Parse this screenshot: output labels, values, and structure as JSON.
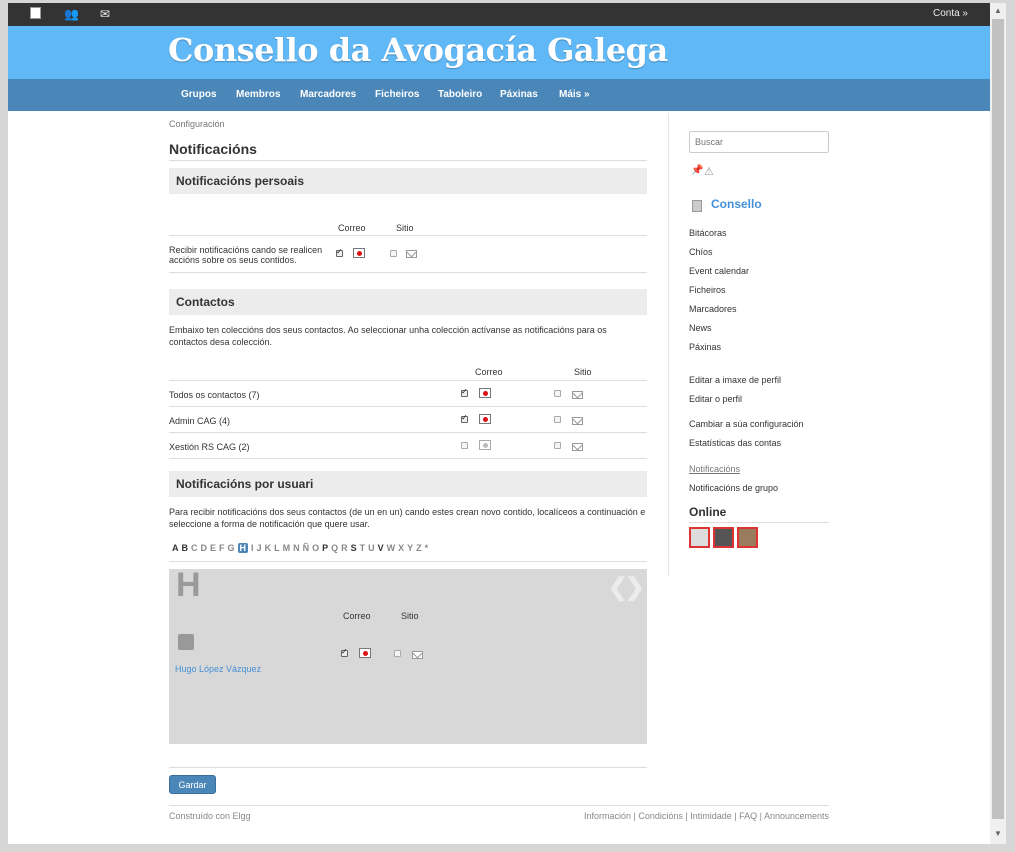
{
  "topbar": {
    "account": "Conta »"
  },
  "site": {
    "title": "Consello da Avogacía Galega"
  },
  "nav": [
    "Grupos",
    "Membros",
    "Marcadores",
    "Ficheiros",
    "Taboleiro",
    "Páxinas",
    "Máis »"
  ],
  "breadcrumb": "Configuración",
  "page_title": "Notificacións",
  "personal": {
    "heading": "Notificacións persoais",
    "col_email": "Correo",
    "col_site": "Sitio",
    "row_label": "Recibir notificacións cando se realicen accións sobre os seus contidos."
  },
  "contacts": {
    "heading": "Contactos",
    "description": "Embaixo ten coleccións dos seus contactos. Ao seleccionar unha colección actívanse as notificacións para os contactos desa colección.",
    "col_email": "Correo",
    "col_site": "Sitio",
    "rows": [
      {
        "label": "Todos os contactos (7)"
      },
      {
        "label": "Admin CAG (4)"
      },
      {
        "label": "Xestión RS CAG (2)"
      }
    ]
  },
  "per_user": {
    "heading": "Notificacións por usuari",
    "description": "Para recibir notificacións dos seus contactos (de un en un) cando estes crean novo contido, localíceos a continuación e seleccione a forma de notificación que quere usar.",
    "alphabet": [
      "A",
      "B",
      "C",
      "D",
      "E",
      "F",
      "G",
      "H",
      "I",
      "J",
      "K",
      "L",
      "M",
      "N",
      "Ñ",
      "O",
      "P",
      "Q",
      "R",
      "S",
      "T",
      "U",
      "V",
      "W",
      "X",
      "Y",
      "Z",
      "*"
    ],
    "selected_letter": "H",
    "big_letter": "H",
    "col_email": "Correo",
    "col_site": "Sitio",
    "user_name": "Hugo López Vázquez"
  },
  "save_label": "Gardar",
  "footer": {
    "built": "Construído con Elgg",
    "links": [
      "Información",
      "Condicións",
      "Intimidade",
      "FAQ",
      "Announcements"
    ]
  },
  "sidebar": {
    "search_placeholder": "Buscar",
    "owner_name": "Consello",
    "menu1": [
      "Bitácoras",
      "Chíos",
      "Event calendar",
      "Ficheiros",
      "Marcadores",
      "News",
      "Páxinas"
    ],
    "menu2": [
      "Editar a imaxe de perfil",
      "Editar o perfil"
    ],
    "menu3": [
      "Cambiar a súa configuración",
      "Estatísticas das contas"
    ],
    "menu4": [
      "Notificacións",
      "Notificacións de grupo"
    ],
    "online_heading": "Online"
  }
}
